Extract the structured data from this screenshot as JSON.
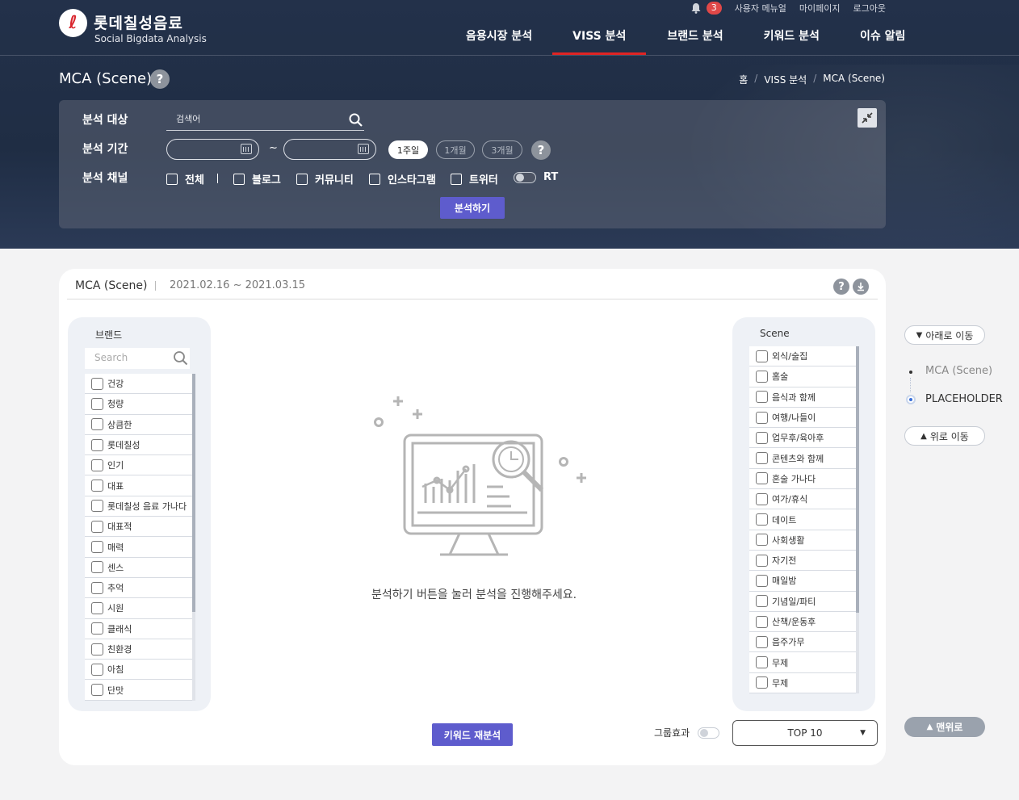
{
  "brand": {
    "title": "롯데칠성음료",
    "subtitle": "Social Bigdata Analysis",
    "logo_glyph": "ℓ"
  },
  "util": {
    "notif_count": "3",
    "manual": "사용자 메뉴얼",
    "mypage": "마이페이지",
    "logout": "로그아웃"
  },
  "nav": [
    "음용시장 분석",
    "VISS 분석",
    "브랜드 분석",
    "키워드 분석",
    "이슈 알림"
  ],
  "page": {
    "title": "MCA (Scene)",
    "help": "?"
  },
  "breadcrumb": [
    "홈",
    "VISS 분석",
    "MCA (Scene)"
  ],
  "filter": {
    "target_label": "분석 대상",
    "search_placeholder": "검색어",
    "period_label": "분석 기간",
    "tilde": "~",
    "periods": [
      "1주일",
      "1개월",
      "3개월"
    ],
    "help": "?",
    "channel_label": "분석 채널",
    "channels": [
      "전체",
      "블로그",
      "커뮤니티",
      "인스타그램",
      "트위터"
    ],
    "rt_label": "RT",
    "analyze_label": "분석하기"
  },
  "card": {
    "title": "MCA (Scene)",
    "date_range": "2021.02.16 ~ 2021.03.15",
    "help": "?",
    "brand_panel": {
      "title": "브랜드",
      "search_placeholder": "Search",
      "items": [
        "건강",
        "청량",
        "상큼한",
        "롯데칠성",
        "인기",
        "대표",
        "롯데칠성 음료 가나다",
        "대표적",
        "매력",
        "센스",
        "추억",
        "시원",
        "클래식",
        "친환경",
        "아침",
        "단맛"
      ]
    },
    "scene_panel": {
      "title": "Scene",
      "items": [
        "외식/술집",
        "홈술",
        "음식과 함께",
        "여행/나들이",
        "업무후/육아후",
        "콘텐츠와 함께",
        "혼술 가나다",
        "여가/휴식",
        "데이트",
        "사회생활",
        "자기전",
        "매일밤",
        "기념일/파티",
        "산책/운동후",
        "음주가무",
        "무제",
        "무제"
      ]
    },
    "empty_message": "분석하기 버튼을 눌러 분석을 진행해주세요.",
    "reanalyze_label": "키워드 재분석",
    "group_effect_label": "그룹효과",
    "top_select": "TOP 10"
  },
  "quicknav": {
    "down_label": "아래로 이동",
    "items": [
      "MCA (Scene)",
      "PLACEHOLDER"
    ],
    "up_label": "위로 이동",
    "top_label": "맨위로"
  },
  "colors": {
    "header_bg": "#23314a",
    "accent": "#5e5ccd",
    "active_nav": "#e02424",
    "badge": "#e04848"
  }
}
